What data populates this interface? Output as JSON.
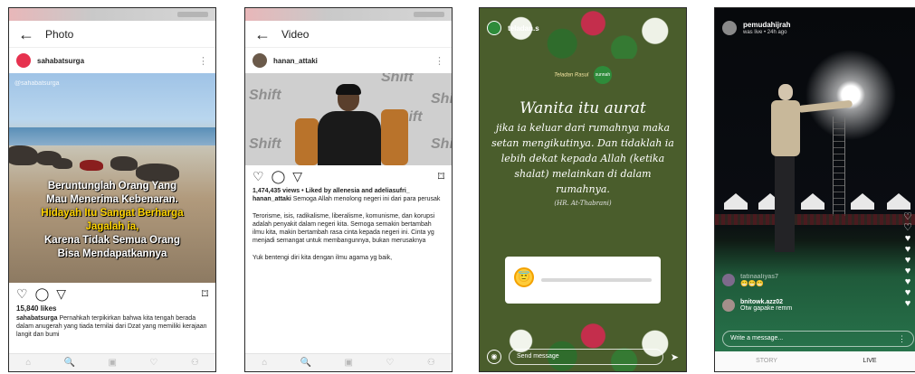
{
  "panel1": {
    "header_title": "Photo",
    "username": "sahabatsurga",
    "image_watermark": "@sahabatsurga",
    "caption_lines": [
      {
        "text": "Beruntunglah Orang Yang",
        "color": "#ffffff"
      },
      {
        "text": "Mau Menerima Kebenaran.",
        "color": "#ffffff"
      },
      {
        "text": "Hidayah Itu Sangat Berharga",
        "color": "#ffd400"
      },
      {
        "text": "Jagalah ia,",
        "color": "#ffd400"
      },
      {
        "text": "Karena Tidak Semua Orang",
        "color": "#ffffff"
      },
      {
        "text": "Bisa Mendapatkannya",
        "color": "#ffffff"
      }
    ],
    "likes": "15,840 likes",
    "caption_user": "sahabatsurga",
    "caption_text": "Pernahkah terpikirkan bahwa kita tengah berada dalam anugerah yang tiada ternilai dari Dzat yang memiliki kerajaan langit dan bumi"
  },
  "panel2": {
    "header_title": "Video",
    "username": "hanan_attaki",
    "wall_text": [
      "Shift",
      "Shift",
      "Shift",
      "Shift",
      "Shift",
      "Shift"
    ],
    "views_line": "1,474,435 views • Liked by allenesia and adeliasufri_",
    "caption_user": "hanan_attaki",
    "caption_text": "Semoga Allah menolong negeri ini dari para perusak",
    "paragraph1": "Terorisme, isis, radikalisme, liberalisme, komunisme, dan korupsi adalah penyakit dalam negeri kita. Semoga semakin bertambah ilmu kita, makin bertambah rasa cinta kepada negeri ini. Cinta yg menjadi semangat untuk membangunnya, bukan merusaknya",
    "paragraph2": "Yuk bentengi diri kita dengan ilmu agama yg baik,"
  },
  "panel3": {
    "username": "teladan.s",
    "brand_text": "Teladan Rasul",
    "brand_badge": "sunnah",
    "quote_title": "Wanita itu aurat",
    "quote_body": "jika ia keluar dari rumahnya maka setan mengikutinya. Dan tidaklah ia lebih dekat kepada Allah (ketika shalat) melainkan di dalam rumahnya.",
    "quote_source": "(HR. At-Thabrani)",
    "poll_emoji": "😇",
    "send_placeholder": "Send message"
  },
  "panel4": {
    "username": "pemudahijrah",
    "subtitle": "was live • 24h ago",
    "comments": [
      {
        "user": "tatinaaliyas7",
        "text": "😁😁😁"
      },
      {
        "user": "bnitowk.azz02",
        "text": "Otw gapake remm"
      }
    ],
    "message_placeholder": "Write a message...",
    "tab_story": "STORY",
    "tab_live": "LIVE"
  },
  "icons": {
    "back": "←",
    "heart": "♡",
    "comment": "◯",
    "share": "▽",
    "bookmark": "⌑",
    "kebab": "⋮",
    "nav_home": "⌂",
    "nav_search": "🔍",
    "nav_add": "▣",
    "nav_activity": "♡",
    "nav_profile": "⚇"
  }
}
